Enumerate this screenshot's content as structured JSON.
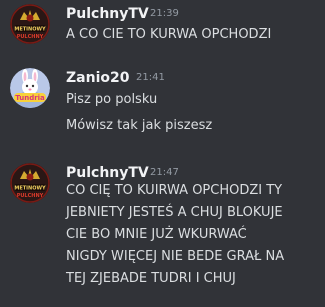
{
  "messages": [
    {
      "username": "PulchnyTV",
      "timestamp": "21:39",
      "avatar_icon": "metinowy-pulchny-logo",
      "avatar_text": [
        "METINOWY",
        "PULCHNY"
      ],
      "lines": [
        "A CO CIE TO KURWA OPCHODZI"
      ]
    },
    {
      "username": "Zanio20",
      "timestamp": "21:41",
      "avatar_icon": "tundria-bunny-logo",
      "avatar_text": [
        "Tundria"
      ],
      "lines": [
        "Pisz po polsku",
        "Mówisz tak jak piszesz"
      ]
    },
    {
      "username": "PulchnyTV",
      "timestamp": "21:47",
      "avatar_icon": "metinowy-pulchny-logo",
      "avatar_text": [
        "METINOWY",
        "PULCHNY"
      ],
      "lines": [
        "CO CIĘ TO KUIRWA OPCHODZI TY",
        "JEBNIETY JESTEŚ A CHUJ BLOKUJE",
        "CIE BO MNIE JUŻ WKURWAĆ",
        "NIGDY WIĘCEJ NIE BEDE GRAŁ NA",
        "TEJ ZJEBADE TUDRI I CHUJ"
      ]
    }
  ]
}
